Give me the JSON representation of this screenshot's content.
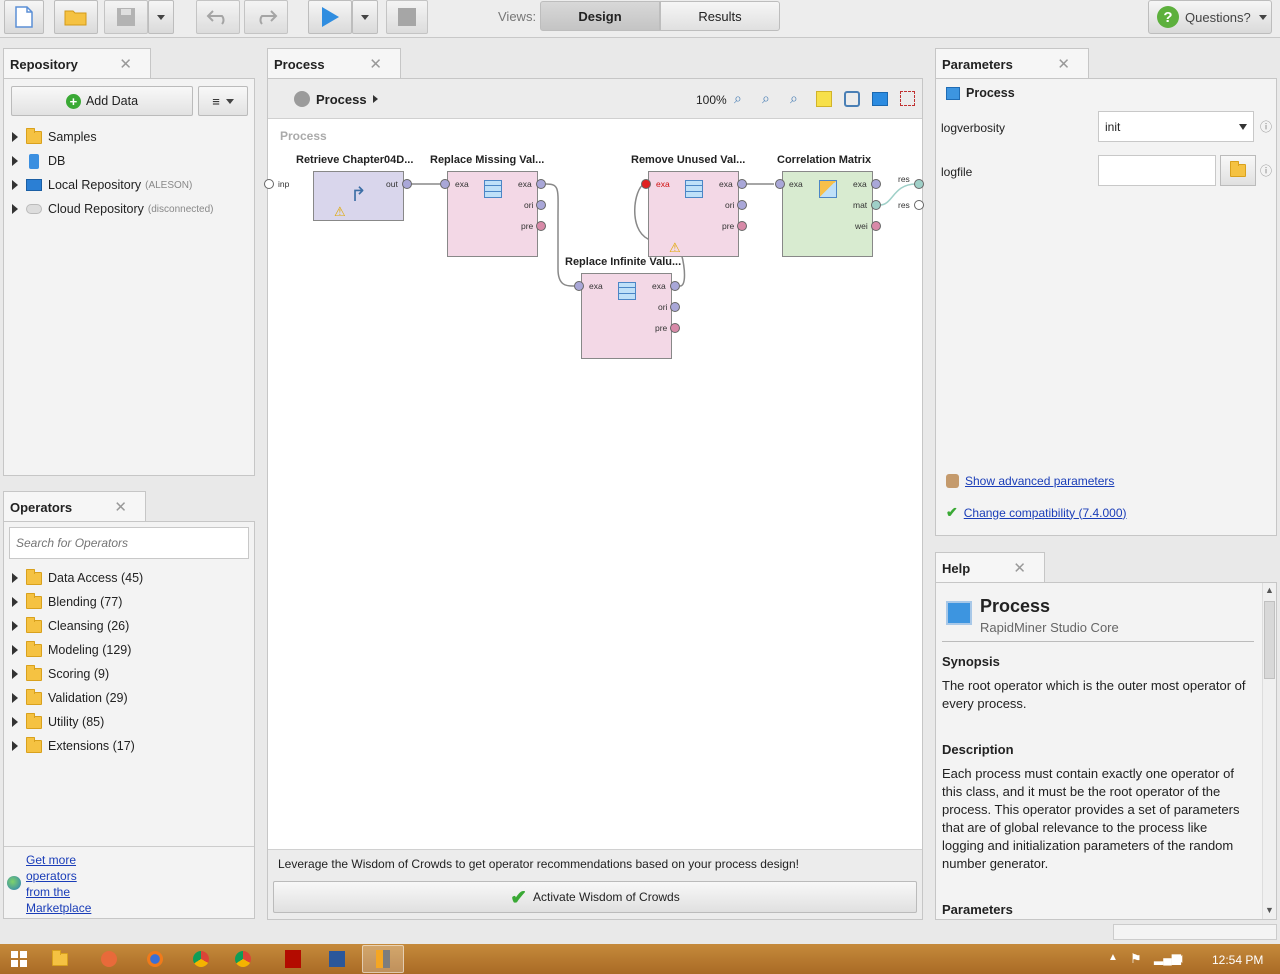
{
  "toolbar": {
    "views_label": "Views:",
    "view_design": "Design",
    "view_results": "Results",
    "questions": "Questions?"
  },
  "repository": {
    "tab": "Repository",
    "add_data": "Add Data",
    "items": [
      {
        "label": "Samples",
        "note": ""
      },
      {
        "label": "DB",
        "note": ""
      },
      {
        "label": "Local Repository",
        "note": "(ALESON)"
      },
      {
        "label": "Cloud Repository",
        "note": "(disconnected)"
      }
    ]
  },
  "operators": {
    "tab": "Operators",
    "search_placeholder": "Search for Operators",
    "items": [
      "Data Access (45)",
      "Blending (77)",
      "Cleansing (26)",
      "Modeling (129)",
      "Scoring (9)",
      "Validation (29)",
      "Utility (85)",
      "Extensions (17)"
    ],
    "marketplace_link": [
      "Get more",
      "operators",
      "from the",
      "Marketplace"
    ]
  },
  "process": {
    "tab": "Process",
    "breadcrumb": "Process",
    "zoom": "100%",
    "canvas_label": "Process",
    "left_port": "inp",
    "right_ports": [
      "res",
      "res"
    ],
    "operators": [
      {
        "title": "Retrieve Chapter04D...",
        "ports": [
          "out"
        ]
      },
      {
        "title": "Replace Missing Val...",
        "ports": [
          "exa",
          "exa",
          "ori",
          "pre"
        ]
      },
      {
        "title": "Replace Infinite Valu...",
        "ports": [
          "exa",
          "exa",
          "ori",
          "pre"
        ]
      },
      {
        "title": "Remove Unused Val...",
        "ports": [
          "exa",
          "exa",
          "ori",
          "pre"
        ]
      },
      {
        "title": "Correlation Matrix",
        "ports": [
          "exa",
          "exa",
          "mat",
          "wei"
        ]
      }
    ],
    "wisdom_text": "Leverage the Wisdom of Crowds to get operator recommendations based on your process design!",
    "wisdom_button": "Activate Wisdom of Crowds"
  },
  "parameters": {
    "tab": "Parameters",
    "operator": "Process",
    "logverbosity_label": "logverbosity",
    "logverbosity_value": "init",
    "logfile_label": "logfile",
    "logfile_value": "",
    "advanced_link": "Show advanced parameters",
    "compat_link": "Change compatibility (7.4.000)"
  },
  "help": {
    "tab": "Help",
    "title": "Process",
    "subtitle": "RapidMiner Studio Core",
    "synopsis_heading": "Synopsis",
    "synopsis": "The root operator which is the outer most operator of every process.",
    "description_heading": "Description",
    "description": "Each process must contain exactly one operator of this class, and it must be the root operator of the process. This operator provides a set of parameters that are of global relevance to the process like logging and initialization parameters of the random number generator.",
    "parameters_heading": "Parameters"
  },
  "taskbar": {
    "clock": "12:54 PM"
  }
}
